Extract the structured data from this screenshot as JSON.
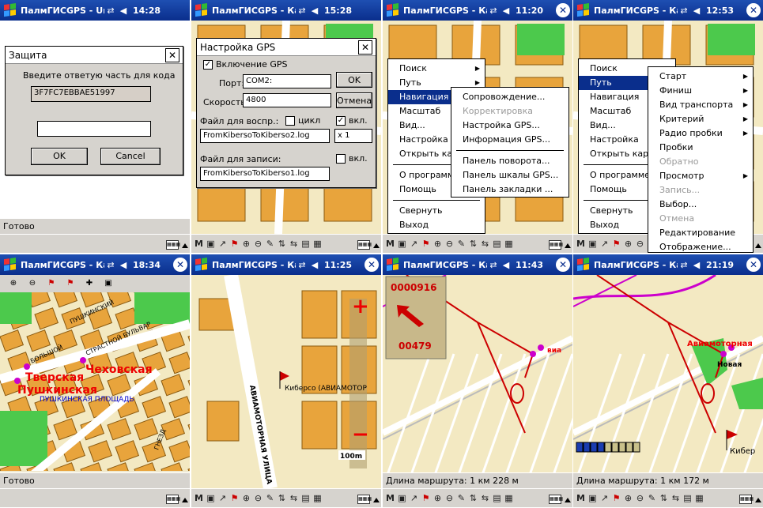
{
  "screens": [
    {
      "title": "ПалмГИСGPS - Unti",
      "time": "14:28",
      "status": "Готово",
      "dialog": {
        "title": "Защита",
        "prompt": "Введите ответую часть  для кода",
        "code": "3F7FC7EBBAE51997",
        "input_value": "",
        "ok": "OK",
        "cancel": "Cancel"
      }
    },
    {
      "title": "ПалмГИСGPS - Кар",
      "time": "15:28",
      "gps": {
        "title": "Настройка GPS",
        "enable": "Включение GPS",
        "port_label": "Порт:",
        "port_value": "COM2:",
        "ok": "OK",
        "speed_label": "Скорость:",
        "speed_value": "4800",
        "cancel": "Отмена",
        "play_label": "Файл для воспр.:",
        "cycle": "цикл",
        "on1": "вкл.",
        "play_file": "FromKibersoToKiberso2.log",
        "mult": "x 1",
        "rec_label": "Файл для записи:",
        "on2": "вкл.",
        "rec_file": "FromKibersoToKiberso1.log"
      }
    },
    {
      "title": "ПалмГИСGPS - Кар",
      "time": "11:20",
      "menu": [
        "Поиск",
        "Путь",
        "Навигация",
        "Масштаб",
        "Вид...",
        "Настройка",
        "Открыть карт",
        "О программе...",
        "Помощь",
        "Свернуть",
        "Выход"
      ],
      "submenu": [
        "Сопровождение...",
        "Корректировка",
        "Настройка GPS...",
        "Информация GPS...",
        "Панель поворота...",
        "Панель шкалы GPS...",
        "Панель закладки ..."
      ]
    },
    {
      "title": "ПалмГИСGPS - Кар",
      "time": "12:53",
      "menu": [
        "Поиск",
        "Путь",
        "Навигация",
        "Масштаб",
        "Вид...",
        "Настройка",
        "Открыть карт",
        "О программе...",
        "Помощь",
        "Свернуть",
        "Выход"
      ],
      "submenu": [
        "Старт",
        "Финиш",
        "Вид транспорта",
        "Критерий",
        "Радио пробки",
        "Пробки",
        "Обратно",
        "Просмотр",
        "Запись...",
        "Выбор...",
        "Отмена",
        "Редактирование",
        "Отображение..."
      ]
    },
    {
      "title": "ПалмГИСGPS - Кар",
      "time": "18:34",
      "status": "Готово",
      "labels": {
        "l1": "Чеховская",
        "l2": "Тверская",
        "l3": "Пушкинская",
        "l4": "ПУШКИНСКАЯ ПЛОЩАДЬ",
        "l5": "ПУШКИНСКИЙ",
        "l6": "БОЛЬШОЙ",
        "l7": "СТРАСТНОЙ БУЛЬВАР",
        "l8": "ГНЕЗД"
      }
    },
    {
      "title": "ПалмГИСGPS - Кар",
      "time": "11:25",
      "labels": {
        "l1": "Киберсо (АВИАМОТОР",
        "l2": "АВИАМОТОРНАЯ УЛИЦА",
        "scale": "100m"
      }
    },
    {
      "title": "ПалмГИСGPS - Кар",
      "time": "11:43",
      "status": "Длина маршрута: 1 км 228 м",
      "panel": {
        "dist1": "0000916",
        "dist2": "00479"
      },
      "labels": {
        "l1": "виа"
      }
    },
    {
      "title": "ПалмГИСGPS - Кар",
      "time": "21:19",
      "status": "Длина маршрута: 1 км 172 м",
      "labels": {
        "l1": "Авиамоторная",
        "l2": "Новая",
        "l3": "Кибер"
      }
    }
  ],
  "colors": {
    "title_bar": "#0a2e8c",
    "menu_select": "#0a2e8c",
    "map_bg": "#f3e9c2",
    "block": "#e8a43c",
    "park": "#4cc94c",
    "route": "#c00000"
  }
}
